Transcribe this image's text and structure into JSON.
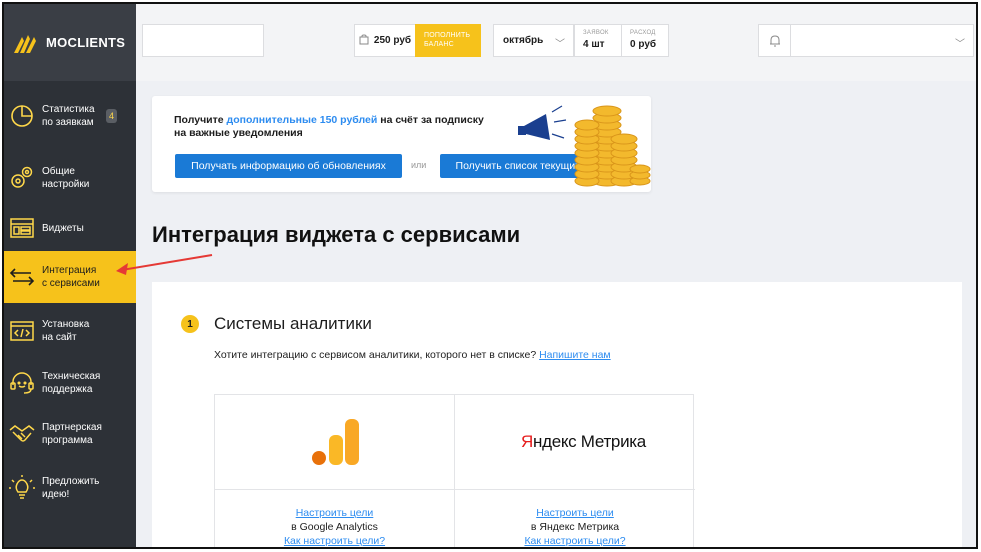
{
  "brand": {
    "name": "MOCLIENTS"
  },
  "sidebar": {
    "items": [
      {
        "label": "Статистика по заявкам",
        "icon": "pie-chart-icon",
        "badge": "4"
      },
      {
        "label": "Общие настройки",
        "icon": "gears-icon"
      },
      {
        "label": "Виджеты",
        "icon": "widgets-icon"
      },
      {
        "label": "Интеграция с сервисами",
        "icon": "arrows-exchange-icon",
        "active": true
      },
      {
        "label": "Установка на сайт",
        "icon": "code-icon"
      },
      {
        "label": "Техническая поддержка",
        "icon": "headset-icon"
      },
      {
        "label": "Партнерская программа",
        "icon": "handshake-icon"
      },
      {
        "label": "Предложить идею!",
        "icon": "lightbulb-icon"
      }
    ]
  },
  "topbar": {
    "search_value": "",
    "balance": "250 руб",
    "topup_label": "ПОПОЛНИТЬ БАЛАНС",
    "month": "октябрь",
    "requests": {
      "caption": "ЗАЯВОК",
      "value": "4 шт"
    },
    "expense": {
      "caption": "РАСХОД",
      "value": "0 руб"
    }
  },
  "promo": {
    "text_before": "Получите ",
    "text_highlight": "дополнительные 150 рублей",
    "text_after": " на счёт за подписку на важные уведомления",
    "btn_updates": "Получать информацию об обновлениях",
    "or_label": "или",
    "btn_offers": "Получить список текущих акций"
  },
  "page": {
    "title": "Интеграция виджета с сервисами"
  },
  "analytics": {
    "step": "1",
    "title": "Системы аналитики",
    "desc": "Хотите интеграцию с сервисом аналитики, которого нет в списке?",
    "desc_link": "Напишите нам",
    "services": [
      {
        "logo_text": "",
        "setup_link": "Настроить цели",
        "subtitle": "в Google Analytics",
        "howto_link": "Как настроить цели?"
      },
      {
        "logo_text_red": "Я",
        "logo_text": "ндекс Метрика",
        "setup_link": "Настроить цели",
        "subtitle": "в Яндекс Метрика",
        "howto_link": "Как настроить цели?"
      }
    ]
  },
  "colors": {
    "accent": "#f6c21b",
    "sidebar": "#2d3137",
    "link": "#2d8cf0",
    "button": "#1a7ad6"
  }
}
